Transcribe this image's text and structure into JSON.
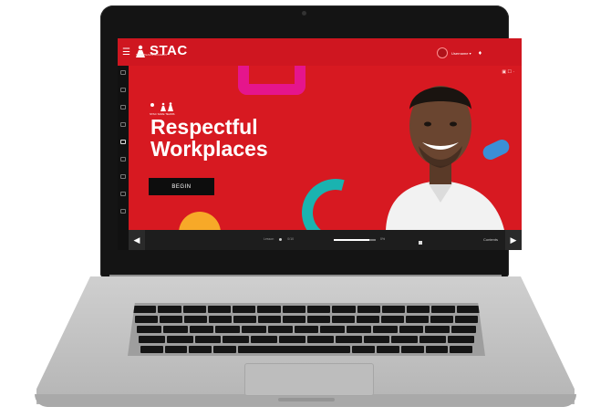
{
  "app": {
    "logo_text": "STAC",
    "logo_tagline": "SAFE TEAMS ACADEMY",
    "user_name": "Username ▾"
  },
  "course": {
    "brand_small": "STAC SAFE TEAMS",
    "title_line1": "Respectful",
    "title_line2": "Workplaces",
    "begin_label": "BEGIN"
  },
  "player": {
    "prev_label": "◀",
    "next_label": "▶",
    "status_left": "Lesson",
    "status_mid": "0/10",
    "status_right": "0%",
    "menu_label": "Contents",
    "progress": 0.85
  },
  "colors": {
    "brand_red": "#d71921",
    "pink": "#e5158c",
    "teal": "#1ab3b0",
    "yellow": "#f7a928",
    "blue": "#3b8fd6"
  },
  "icons": [
    "hamburger-icon",
    "stac-logo-icon",
    "user-avatar-icon",
    "bell-icon",
    "sidebar-icons"
  ]
}
